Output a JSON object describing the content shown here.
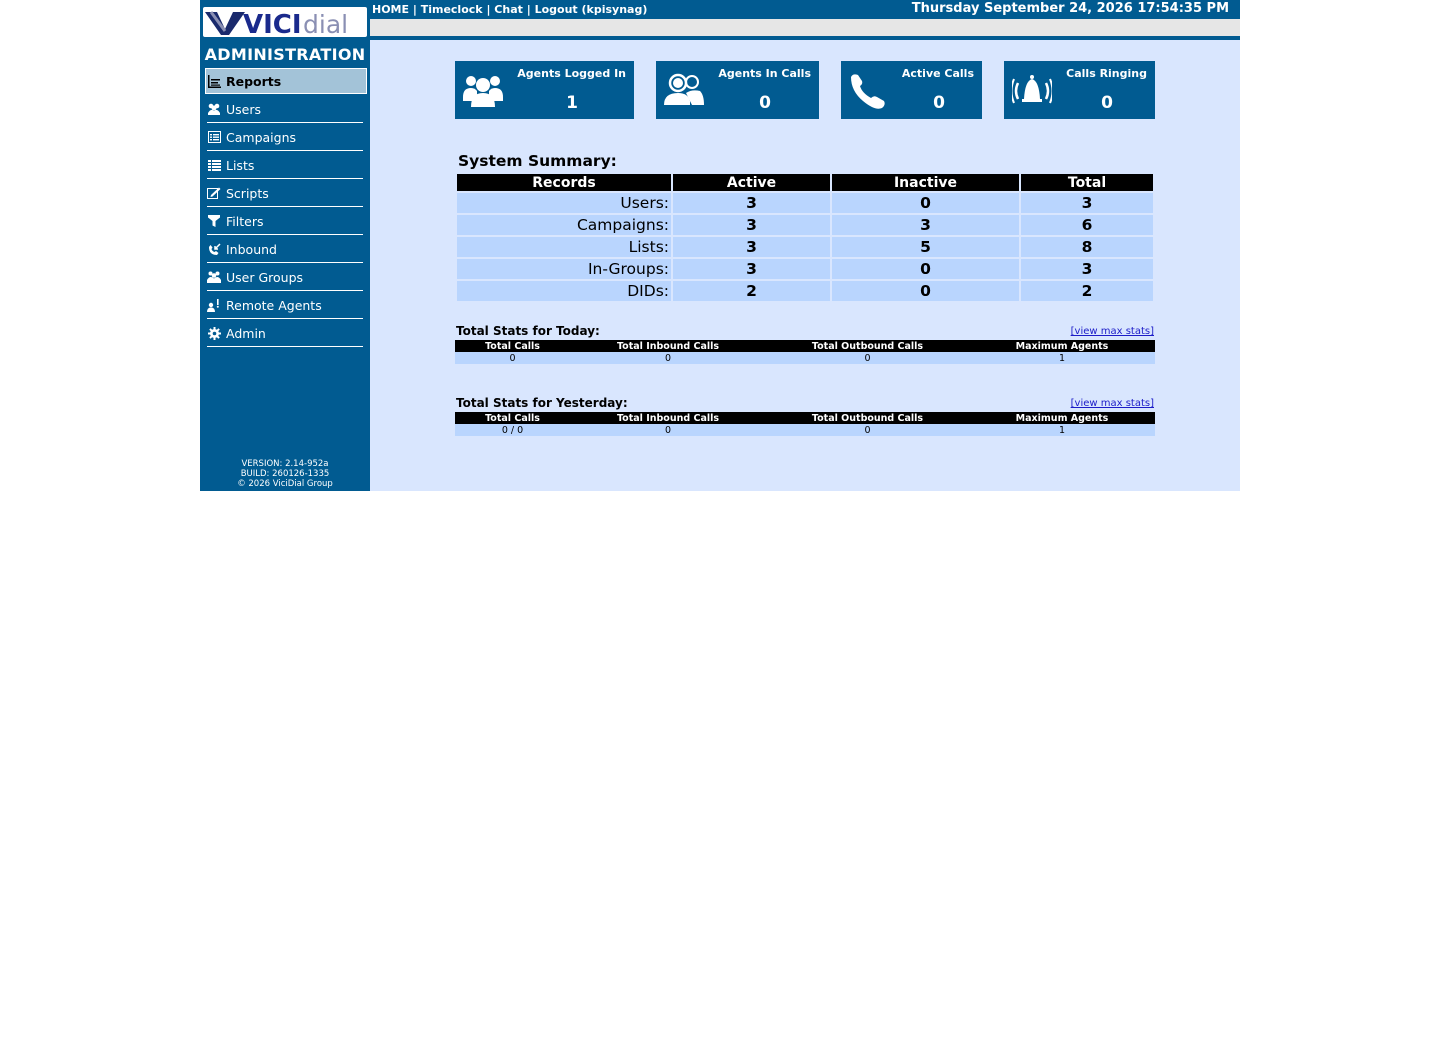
{
  "topbar": {
    "links": [
      "HOME",
      "Timeclock",
      "Chat",
      "Logout (kpisynag)"
    ],
    "separator": " | ",
    "datetime": "Thursday September 24, 2026 17:54:35 PM"
  },
  "sidebar": {
    "logo_text_a": "VICI",
    "logo_text_b": "dial",
    "title": "ADMINISTRATION",
    "items": [
      {
        "label": "Reports",
        "icon": "reports-icon",
        "active": true
      },
      {
        "label": "Users",
        "icon": "users-icon"
      },
      {
        "label": "Campaigns",
        "icon": "campaigns-icon"
      },
      {
        "label": "Lists",
        "icon": "lists-icon"
      },
      {
        "label": "Scripts",
        "icon": "scripts-icon"
      },
      {
        "label": "Filters",
        "icon": "filter-icon"
      },
      {
        "label": "Inbound",
        "icon": "inbound-icon"
      },
      {
        "label": "User Groups",
        "icon": "user-groups-icon"
      },
      {
        "label": "Remote Agents",
        "icon": "remote-agents-icon"
      },
      {
        "label": "Admin",
        "icon": "gear-icon"
      }
    ],
    "version": "VERSION: 2.14-952a",
    "build": "BUILD: 260126-1335",
    "copyright": "© 2026 ViciDial Group"
  },
  "stats_boxes": [
    {
      "label": "Agents Logged In",
      "value": "1",
      "icon": "agents-group-icon"
    },
    {
      "label": "Agents In Calls",
      "value": "0",
      "icon": "agents-headset-icon"
    },
    {
      "label": "Active Calls",
      "value": "0",
      "icon": "phone-icon"
    },
    {
      "label": "Calls Ringing",
      "value": "0",
      "icon": "ringing-bell-icon"
    }
  ],
  "system_summary": {
    "title": "System Summary:",
    "headers": [
      "Records",
      "Active",
      "Inactive",
      "Total"
    ],
    "rows": [
      [
        "Users:",
        "3",
        "0",
        "3"
      ],
      [
        "Campaigns:",
        "3",
        "3",
        "6"
      ],
      [
        "Lists:",
        "3",
        "5",
        "8"
      ],
      [
        "In-Groups:",
        "3",
        "0",
        "3"
      ],
      [
        "DIDs:",
        "2",
        "0",
        "2"
      ]
    ]
  },
  "today": {
    "title": "Total Stats for Today:",
    "link": "[view max stats]",
    "headers": [
      "Total Calls",
      "Total Inbound Calls",
      "Total Outbound Calls",
      "Maximum Agents"
    ],
    "values": [
      "0",
      "0",
      "0",
      "1"
    ]
  },
  "yesterday": {
    "title": "Total Stats for Yesterday:",
    "link": "[view max stats]",
    "headers": [
      "Total Calls",
      "Total Inbound Calls",
      "Total Outbound Calls",
      "Maximum Agents"
    ],
    "values": [
      "0 / 0",
      "0",
      "0",
      "1"
    ]
  },
  "colors": {
    "brand_blue": "#015b91",
    "background": "#d9e6fe",
    "cell": "#b9d5fe",
    "active_nav": "#a3c3d8"
  }
}
